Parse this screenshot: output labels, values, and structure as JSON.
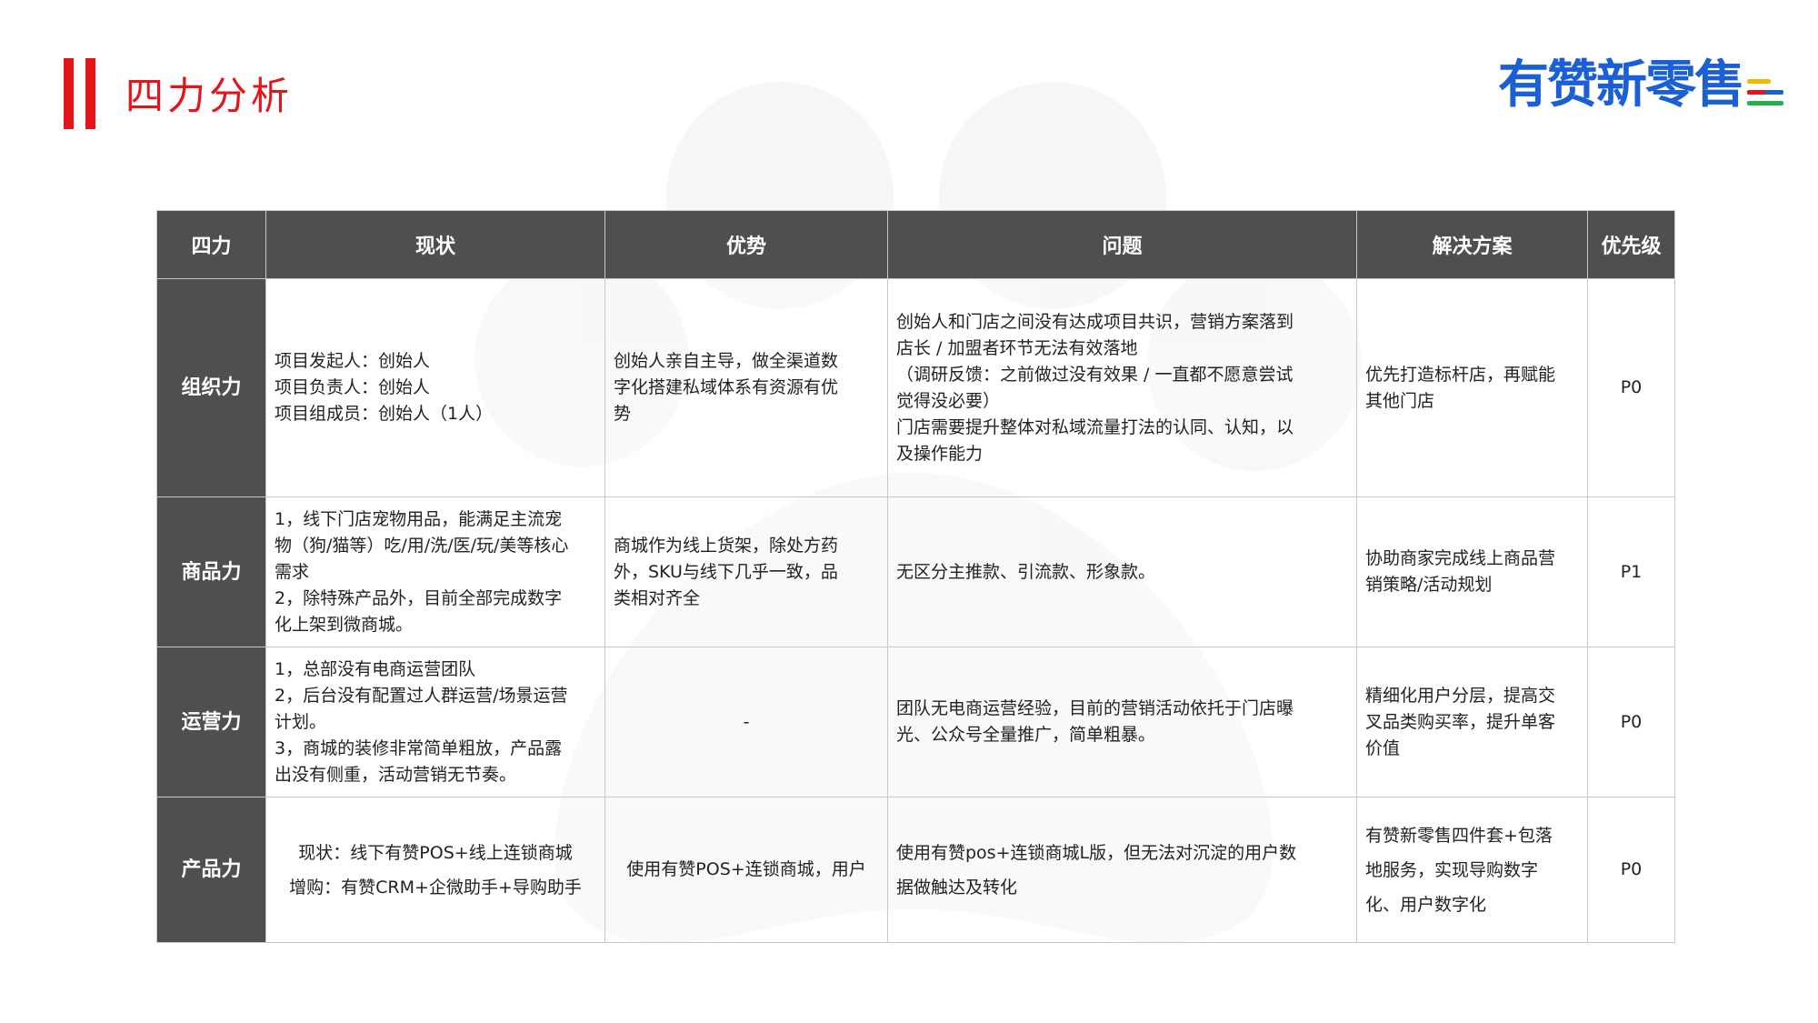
{
  "page": {
    "title": "四力分析"
  },
  "brand": {
    "logo_text": "有赞新零售",
    "line_colors": [
      "#f2b705",
      "#e5141b",
      "#1a5fd6",
      "#1fb24a"
    ]
  },
  "table": {
    "headers": [
      "四力",
      "现状",
      "优势",
      "问题",
      "解决方案",
      "优先级"
    ],
    "rows": [
      {
        "dimension": "组织力",
        "status": [
          "项目发起人：创始人",
          "项目负责人：创始人",
          "项目组成员：创始人（1人）"
        ],
        "advantage": [
          "创始人亲自主导，做全渠道数",
          "字化搭建私域体系有资源有优",
          "势"
        ],
        "problem": [
          "创始人和门店之间没有达成项目共识，营销方案落到",
          "店长 / 加盟者环节无法有效落地",
          "（调研反馈：之前做过没有效果 / 一直都不愿意尝试",
          "觉得没必要）",
          "门店需要提升整体对私域流量打法的认同、认知，以",
          "及操作能力"
        ],
        "solution": [
          "优先打造标杆店，再赋能",
          "其他门店"
        ],
        "priority": "P0"
      },
      {
        "dimension": "商品力",
        "status": [
          "1，线下门店宠物用品，能满足主流宠",
          "物（狗/猫等）吃/用/洗/医/玩/美等核心",
          "需求",
          "2，除特殊产品外，目前全部完成数字",
          "化上架到微商城。"
        ],
        "advantage": [
          "商城作为线上货架，除处方药",
          "外，SKU与线下几乎一致，品",
          "类相对齐全"
        ],
        "problem": [
          "无区分主推款、引流款、形象款。"
        ],
        "solution": [
          "协助商家完成线上商品营",
          "销策略/活动规划"
        ],
        "priority": "P1"
      },
      {
        "dimension": "运营力",
        "status": [
          "1，总部没有电商运营团队",
          "2，后台没有配置过人群运营/场景运营",
          "计划。",
          "3，商城的装修非常简单粗放，产品露",
          "出没有侧重，活动营销无节奏。"
        ],
        "advantage": [
          "-"
        ],
        "problem": [
          "团队无电商运营经验，目前的营销活动依托于门店曝",
          "光、公众号全量推广，简单粗暴。"
        ],
        "solution": [
          "精细化用户分层，提高交",
          "叉品类购买率，提升单客",
          "价值"
        ],
        "priority": "P0"
      },
      {
        "dimension": "产品力",
        "status": [
          "现状：线下有赞POS+线上连锁商城",
          "增购：有赞CRM+企微助手+导购助手"
        ],
        "advantage": [
          "使用有赞POS+连锁商城，用户"
        ],
        "problem": [
          "使用有赞pos+连锁商城L版，但无法对沉淀的用户数",
          "据做触达及转化"
        ],
        "solution": [
          "有赞新零售四件套+包落",
          "地服务，实现导购数字",
          "化、用户数字化"
        ],
        "priority": "P0"
      }
    ]
  }
}
